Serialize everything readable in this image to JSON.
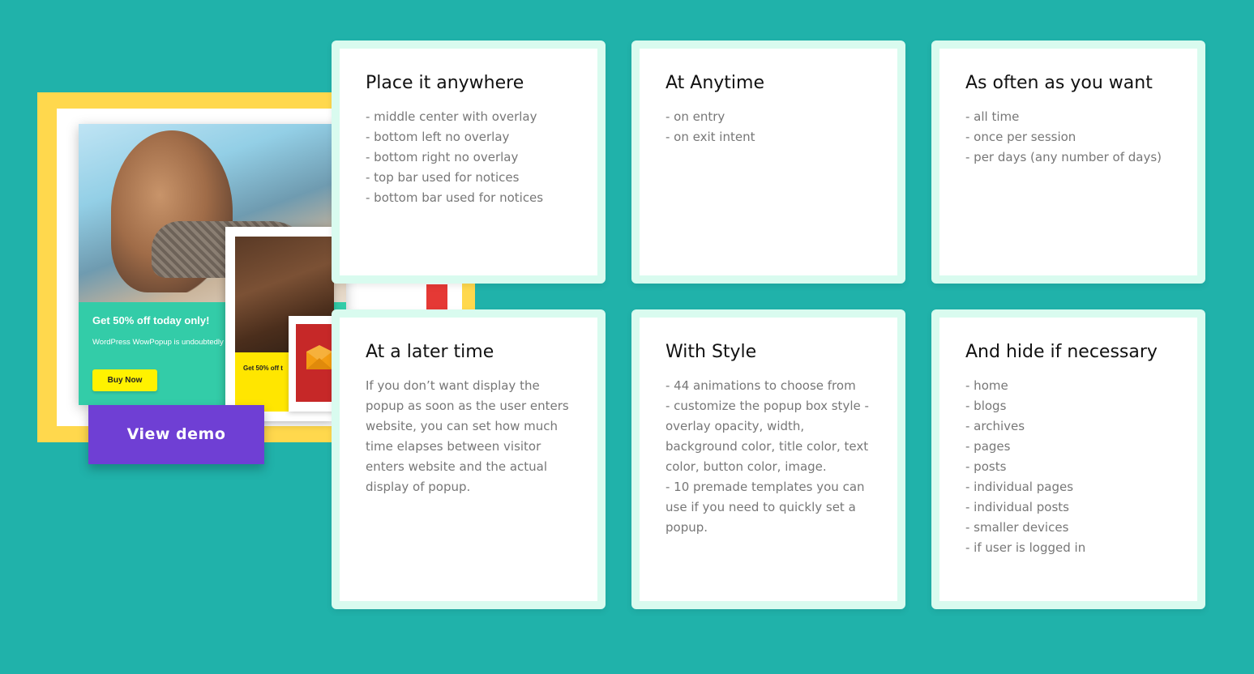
{
  "promo": {
    "popup_title": "Get 50% off today only!",
    "popup_text": "WordPress WowPopup is undoubtedly the best, but really the best!",
    "popup_button": "Buy Now",
    "small_popup_title": "Get 50% off t",
    "view_demo_label": "View demo"
  },
  "cards": [
    {
      "title": "Place it anywhere",
      "items": [
        "- middle center with overlay",
        "- bottom left no overlay",
        "- bottom right no overlay",
        "- top bar used for notices",
        "- bottom bar used for notices"
      ]
    },
    {
      "title": "At Anytime",
      "items": [
        "- on entry",
        "- on exit intent"
      ]
    },
    {
      "title": "As often as you want",
      "items": [
        "- all time",
        "- once per session",
        "- per days (any number of days)"
      ]
    },
    {
      "title": "At a later time",
      "text": "If you don’t want display the popup as soon as the user enters website, you can set how much time elapses between visitor enters website and the actual display of popup."
    },
    {
      "title": "With Style",
      "items": [
        "- 44 animations to choose from",
        "- customize the popup box style - overlay opacity, width, background color, title color, text color, button color, image.",
        "- 10 premade templates you can use if you need to quickly set a popup."
      ]
    },
    {
      "title": "And hide if necessary",
      "items": [
        "- home",
        "- blogs",
        "- archives",
        "- pages",
        "- posts",
        "- individual pages",
        "- individual posts",
        "- smaller devices",
        "- if user is logged in"
      ]
    }
  ],
  "colors": {
    "background": "#20b2aa",
    "card_border": "#d9fbef",
    "button": "#6f3fd4",
    "promo_frame": "#ffd84d"
  }
}
